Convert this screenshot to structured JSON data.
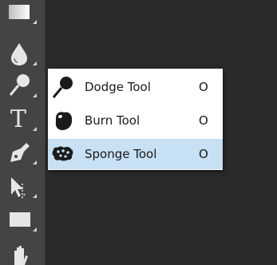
{
  "colors": {
    "toolbar_bg": "#444444",
    "workspace_bg": "#2a2a2a",
    "menu_bg": "#ffffff",
    "selected_bg": "#c7e0f4",
    "icon_light": "#e6e6e6",
    "menu_text": "#1a1a1a"
  },
  "toolbar": {
    "tools": [
      {
        "icon": "gradient-icon"
      },
      {
        "icon": "blur-drop-icon"
      },
      {
        "icon": "dodge-icon"
      },
      {
        "icon": "type-icon",
        "glyph": "T"
      },
      {
        "icon": "pen-icon"
      },
      {
        "icon": "path-selection-icon"
      },
      {
        "icon": "rectangle-icon"
      },
      {
        "icon": "hand-icon"
      }
    ]
  },
  "flyout": {
    "items": [
      {
        "label": "Dodge Tool",
        "shortcut": "O",
        "icon": "dodge-icon",
        "selected": false
      },
      {
        "label": "Burn Tool",
        "shortcut": "O",
        "icon": "burn-icon",
        "selected": false
      },
      {
        "label": "Sponge Tool",
        "shortcut": "O",
        "icon": "sponge-icon",
        "selected": true
      }
    ]
  }
}
